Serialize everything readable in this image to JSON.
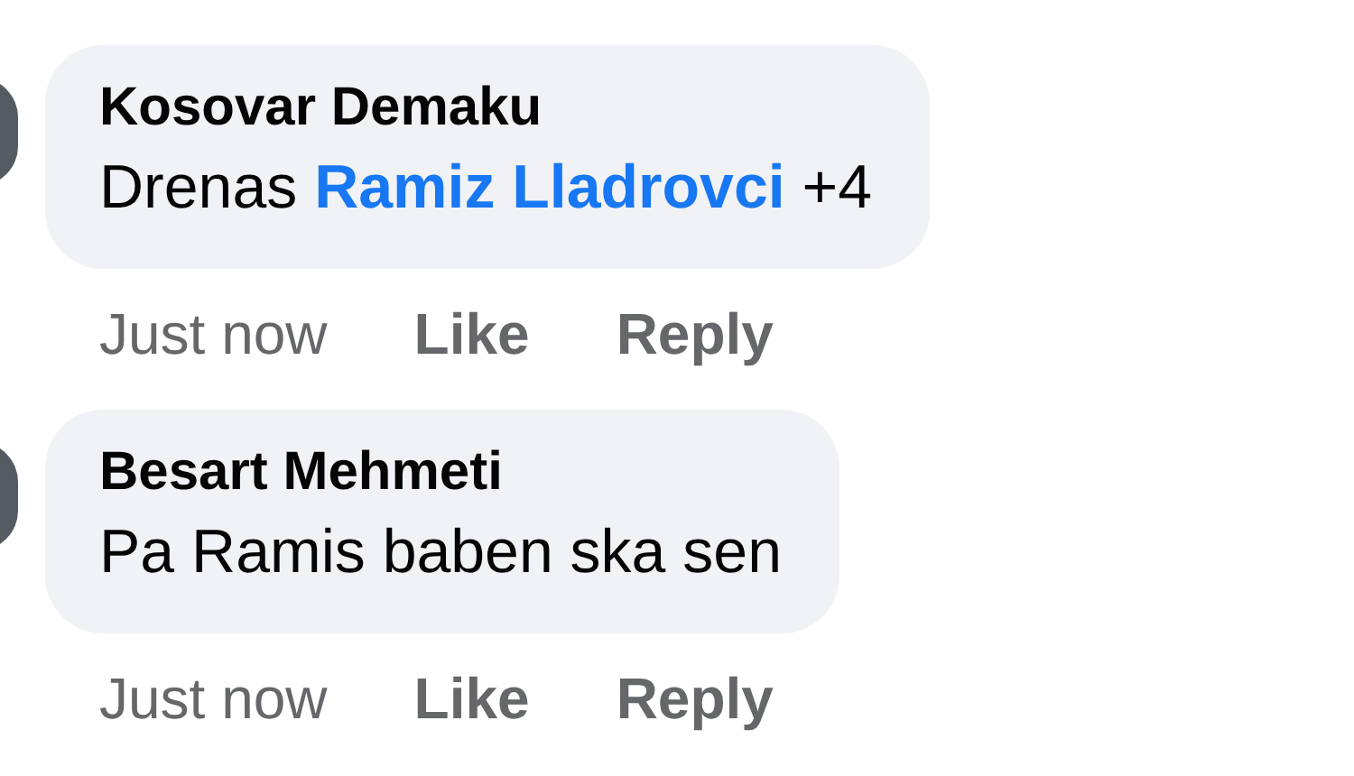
{
  "comments": [
    {
      "author": "Kosovar Demaku",
      "body": [
        {
          "kind": "text",
          "text": "Drenas"
        },
        {
          "kind": "mention",
          "text": "Ramiz Lladrovci"
        },
        {
          "kind": "text",
          "text": "+4"
        }
      ],
      "time": "Just now",
      "actions": [
        "Like",
        "Reply"
      ]
    },
    {
      "author": "Besart Mehmeti",
      "body": [
        {
          "kind": "text",
          "text": "Pa Ramis baben ska sen"
        }
      ],
      "time": "Just now",
      "actions": [
        "Like",
        "Reply"
      ]
    }
  ]
}
